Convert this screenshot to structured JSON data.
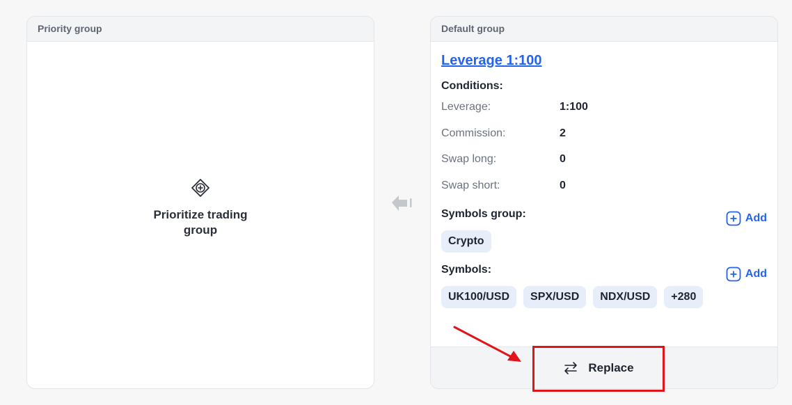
{
  "priority_group": {
    "header": "Priority group",
    "empty_label": "Prioritize trading group",
    "icon": "plus-diamond-icon"
  },
  "default_group": {
    "header": "Default group",
    "title": "Leverage 1:100",
    "conditions_title": "Conditions:",
    "conditions": [
      {
        "label": "Leverage:",
        "value": "1:100"
      },
      {
        "label": "Commission:",
        "value": "2"
      },
      {
        "label": "Swap long:",
        "value": "0"
      },
      {
        "label": "Swap short:",
        "value": "0"
      }
    ],
    "symbols_group_title": "Symbols group:",
    "symbols_group_chips": [
      "Crypto"
    ],
    "symbols_title": "Symbols:",
    "symbol_chips": [
      "UK100/USD",
      "SPX/USD",
      "NDX/USD",
      "+280"
    ],
    "add_label": "Add",
    "replace_label": "Replace"
  },
  "colors": {
    "link": "#2563eb",
    "highlight": "#e0141b",
    "chip_bg": "#e8eef9"
  }
}
